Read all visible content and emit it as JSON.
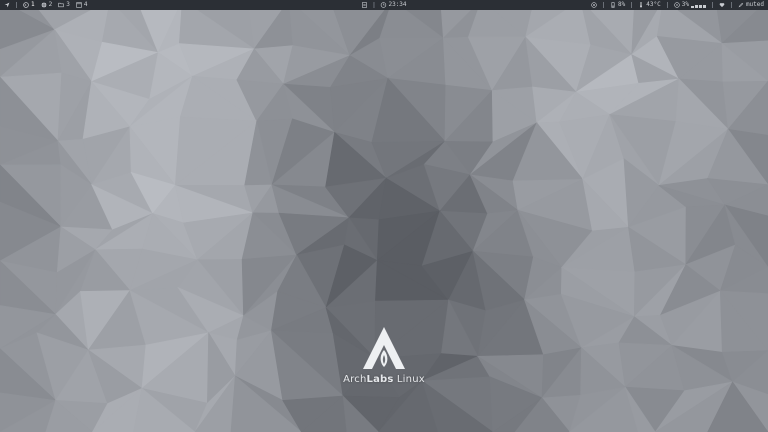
{
  "theme": {
    "bar_bg": "#2b2f35",
    "bar_fg": "#c9ccd1",
    "wallpaper_dark": "#2e3033",
    "wallpaper_light": "#c3c7cc"
  },
  "bar": {
    "launcher_icon": "arrow-icon",
    "workspaces": [
      {
        "icon": "terminal-icon",
        "label": "1"
      },
      {
        "icon": "globe-icon",
        "label": "2"
      },
      {
        "icon": "folder-icon",
        "label": "3"
      },
      {
        "icon": "window-icon",
        "label": "4"
      }
    ],
    "center": {
      "file_icon": "file-icon",
      "clock_icon": "clock-icon",
      "time": "23:34"
    },
    "right": {
      "wifi_icon": "wifi-icon",
      "wifi_value": "8%",
      "temp_icon": "thermometer-icon",
      "temp_value": "43°C",
      "volume_icon": "speaker-icon",
      "volume_value": "3%",
      "network_icon": "heart-icon",
      "status_icon": "pen-icon",
      "status_text": "muted"
    },
    "net_levels": [
      0.3,
      0.5,
      0.5,
      0.5
    ]
  },
  "desktop": {
    "logo_icon": "archlabs-logo",
    "logo_brand_light": "Arch",
    "logo_brand_bold": "Labs",
    "logo_brand_suffix": " Linux"
  }
}
